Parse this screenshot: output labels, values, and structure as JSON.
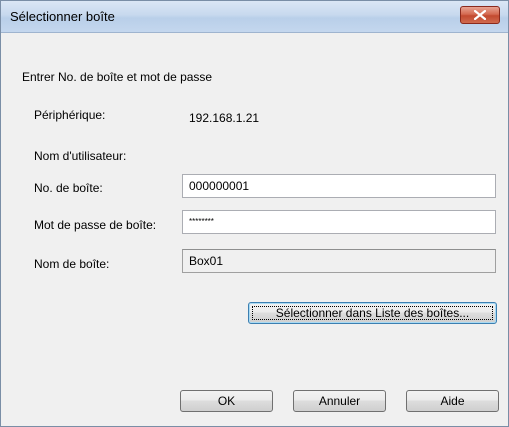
{
  "window": {
    "title": "Sélectionner boîte"
  },
  "form": {
    "instruction": "Entrer No. de boîte et mot de passe",
    "device_label": "Périphérique:",
    "device_value": "192.168.1.21",
    "username_label": "Nom d'utilisateur:",
    "box_number_label": "No. de boîte:",
    "box_number_value": "000000001",
    "box_password_label": "Mot de passe de boîte:",
    "box_password_value": "********",
    "box_name_label": "Nom de boîte:",
    "box_name_value": "Box01"
  },
  "buttons": {
    "select_from_list": "Sélectionner dans Liste des boîtes...",
    "ok": "OK",
    "cancel": "Annuler",
    "help": "Aide"
  },
  "colors": {
    "title_bar": "#c7d9ee",
    "close_button": "#c24a30",
    "dialog_bg": "#f0f0f0"
  }
}
